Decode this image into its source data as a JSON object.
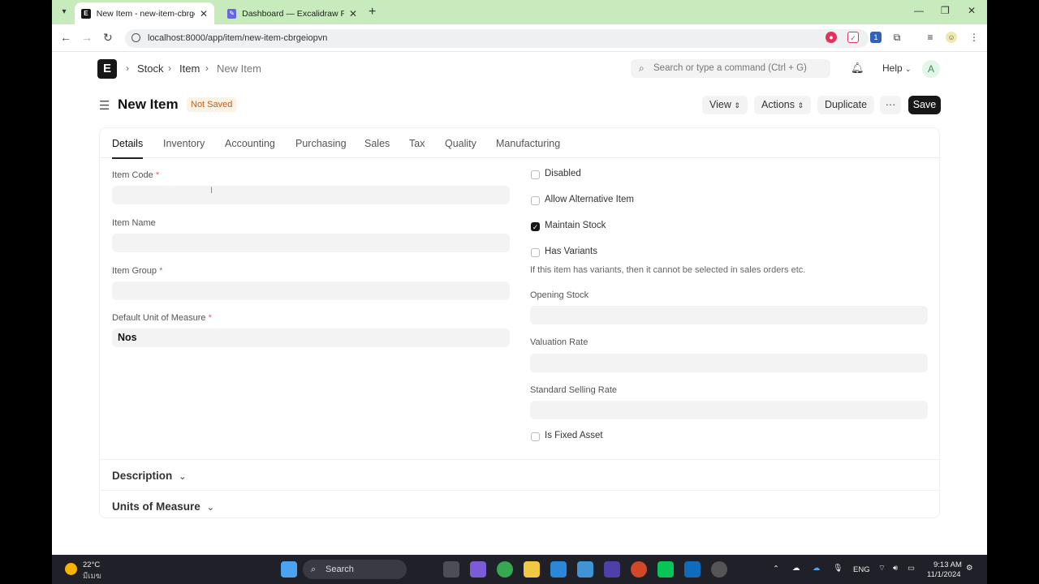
{
  "browser": {
    "tabs": [
      {
        "title": "New Item - new-item-cbrgeiop",
        "active": true
      },
      {
        "title": "Dashboard — Excalidraw Plus",
        "active": false
      }
    ],
    "url": "localhost:8000/app/item/new-item-cbrgeiopvn"
  },
  "navbar": {
    "logo": "E",
    "breadcrumbs": [
      "Stock",
      "Item",
      "New Item"
    ],
    "search_placeholder": "Search or type a command (Ctrl + G)",
    "help_label": "Help",
    "avatar_initial": "A"
  },
  "page": {
    "title": "New Item",
    "status": "Not Saved",
    "buttons": {
      "view": "View",
      "actions": "Actions",
      "duplicate": "Duplicate",
      "more": "···",
      "save": "Save"
    }
  },
  "form_tabs": [
    "Details",
    "Inventory",
    "Accounting",
    "Purchasing",
    "Sales",
    "Tax",
    "Quality",
    "Manufacturing"
  ],
  "left_fields": [
    {
      "label": "Item Code",
      "required": true,
      "value": ""
    },
    {
      "label": "Item Name",
      "required": false,
      "value": ""
    },
    {
      "label": "Item Group",
      "required": true,
      "value": ""
    },
    {
      "label": "Default Unit of Measure",
      "required": true,
      "value": "Nos"
    }
  ],
  "checkboxes": [
    {
      "label": "Disabled",
      "checked": false
    },
    {
      "label": "Allow Alternative Item",
      "checked": false
    },
    {
      "label": "Maintain Stock",
      "checked": true
    },
    {
      "label": "Has Variants",
      "checked": false
    }
  ],
  "variants_help": "If this item has variants, then it cannot be selected in sales orders etc.",
  "right_fields": [
    {
      "label": "Opening Stock",
      "value": ""
    },
    {
      "label": "Valuation Rate",
      "value": ""
    },
    {
      "label": "Standard Selling Rate",
      "value": ""
    }
  ],
  "fixed_asset": {
    "label": "Is Fixed Asset",
    "checked": false
  },
  "sections": [
    "Description",
    "Units of Measure"
  ],
  "taskbar": {
    "weather_temp": "22°C",
    "weather_desc": "มีเมฆ",
    "search_label": "Search",
    "lang": "ENG",
    "time": "9:13 AM",
    "date": "11/1/2024"
  },
  "colors": {
    "accent": "#171717",
    "status_badge": "#c25d12",
    "tabbar": "#c7ebbc"
  }
}
